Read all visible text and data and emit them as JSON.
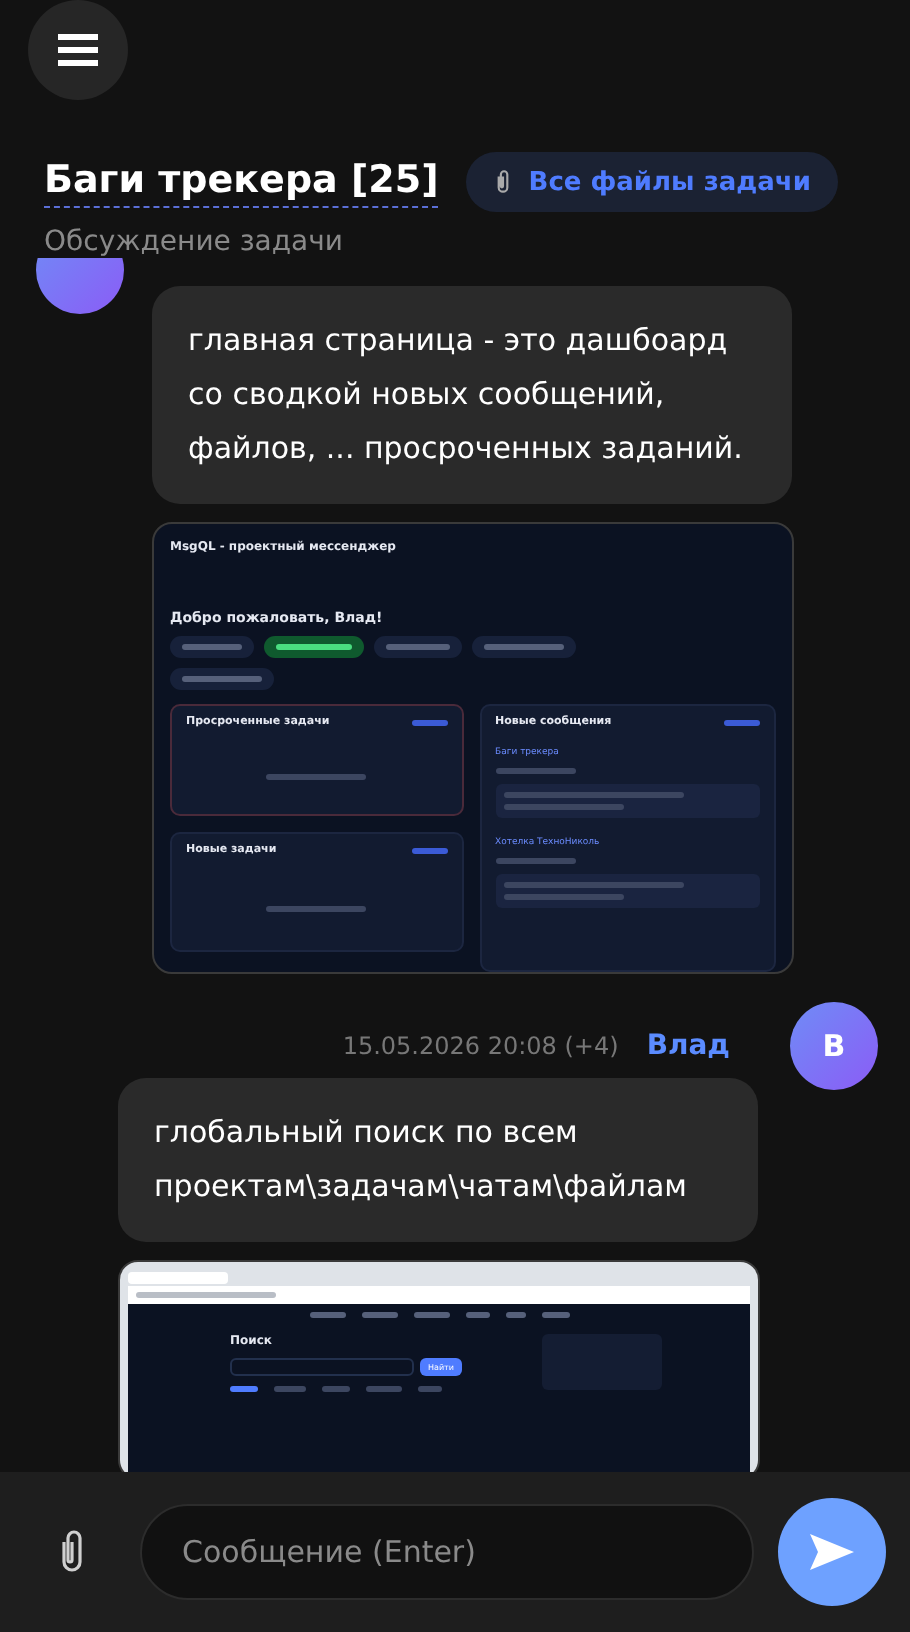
{
  "header": {
    "title": "Баги трекера [25]",
    "files_button": "Все файлы задачи",
    "subtitle": "Обсуждение задачи"
  },
  "messages": [
    {
      "kind": "incoming",
      "text": "главная страница - это дашбоард со сводкой новых сообщений, файлов, ... просроченных заданий.",
      "attachment": {
        "kind": "dashboard",
        "app_title": "MsgQL - проектный мессенджер",
        "welcome": "Добро пожаловать, Влад!",
        "panels": [
          {
            "title": "Просроченные задачи",
            "alert": true
          },
          {
            "title": "Новые задачи",
            "alert": false
          }
        ],
        "feed": {
          "title": "Новые сообщения",
          "items": [
            "Баги трекера",
            "Хотелка ТехноНиколь"
          ]
        }
      }
    },
    {
      "kind": "outgoing",
      "time": "15.05.2026 20:08 (+4)",
      "author": "Влад",
      "avatar": "В",
      "text": "глобальный поиск по всем проектам\\задачам\\чатам\\файлам",
      "attachment": {
        "kind": "search",
        "heading": "Поиск",
        "button": "Найти"
      }
    }
  ],
  "composer": {
    "placeholder": "Сообщение (Enter)"
  }
}
